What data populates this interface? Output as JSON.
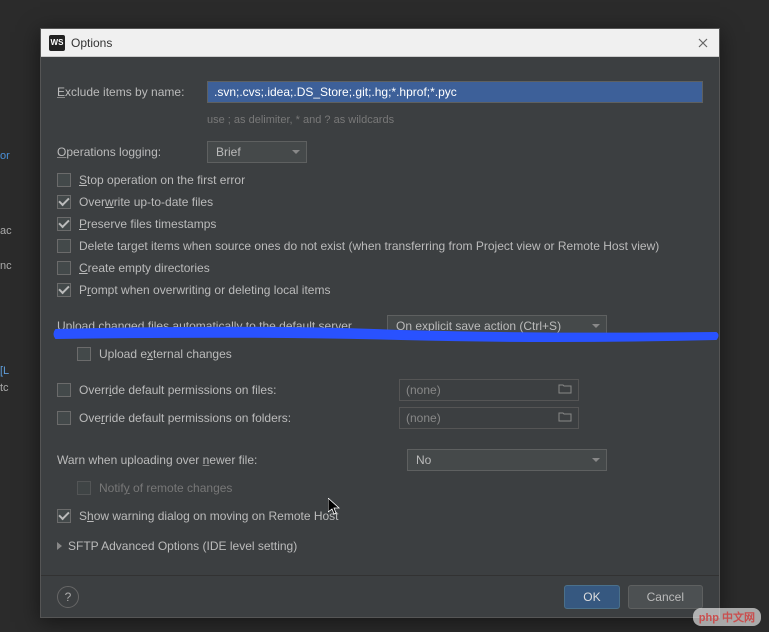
{
  "titlebar": {
    "icon": "WS",
    "title": "Options"
  },
  "exclude": {
    "label": "Exclude items by name:",
    "value": ".svn;.cvs;.idea;.DS_Store;.git;.hg;*.hprof;*.pyc",
    "helper": "use ; as delimiter, * and ? as wildcards"
  },
  "logging": {
    "label": "Operations logging:",
    "value": "Brief"
  },
  "checkboxes": {
    "stop_error": "Stop operation on the first error",
    "overwrite": "Overwrite up-to-date files",
    "preserve": "Preserve files timestamps",
    "delete_target": "Delete target items when source ones do not exist (when transferring from Project view or Remote Host view)",
    "create_empty": "Create empty directories",
    "prompt": "Prompt when overwriting or deleting local items"
  },
  "upload": {
    "label": "Upload changed files automatically to the default server",
    "value": "On explicit save action (Ctrl+S)",
    "external": "Upload external changes"
  },
  "perms": {
    "files_label": "Override default permissions on files:",
    "files_value": "(none)",
    "folders_label": "Override default permissions on folders:",
    "folders_value": "(none)"
  },
  "warn": {
    "label": "Warn when uploading over newer file:",
    "value": "No"
  },
  "notify": "Notify of remote changes",
  "show_warning": "Show warning dialog on moving on Remote Host",
  "sftp": "SFTP Advanced Options (IDE level setting)",
  "footer": {
    "ok": "OK",
    "cancel": "Cancel",
    "help": "?"
  },
  "watermark": "php 中文网",
  "checked": {
    "stop_error": false,
    "overwrite": true,
    "preserve": true,
    "delete_target": false,
    "create_empty": false,
    "prompt": true,
    "external": false,
    "files": false,
    "folders": false,
    "notify": false,
    "show_warning": true
  }
}
